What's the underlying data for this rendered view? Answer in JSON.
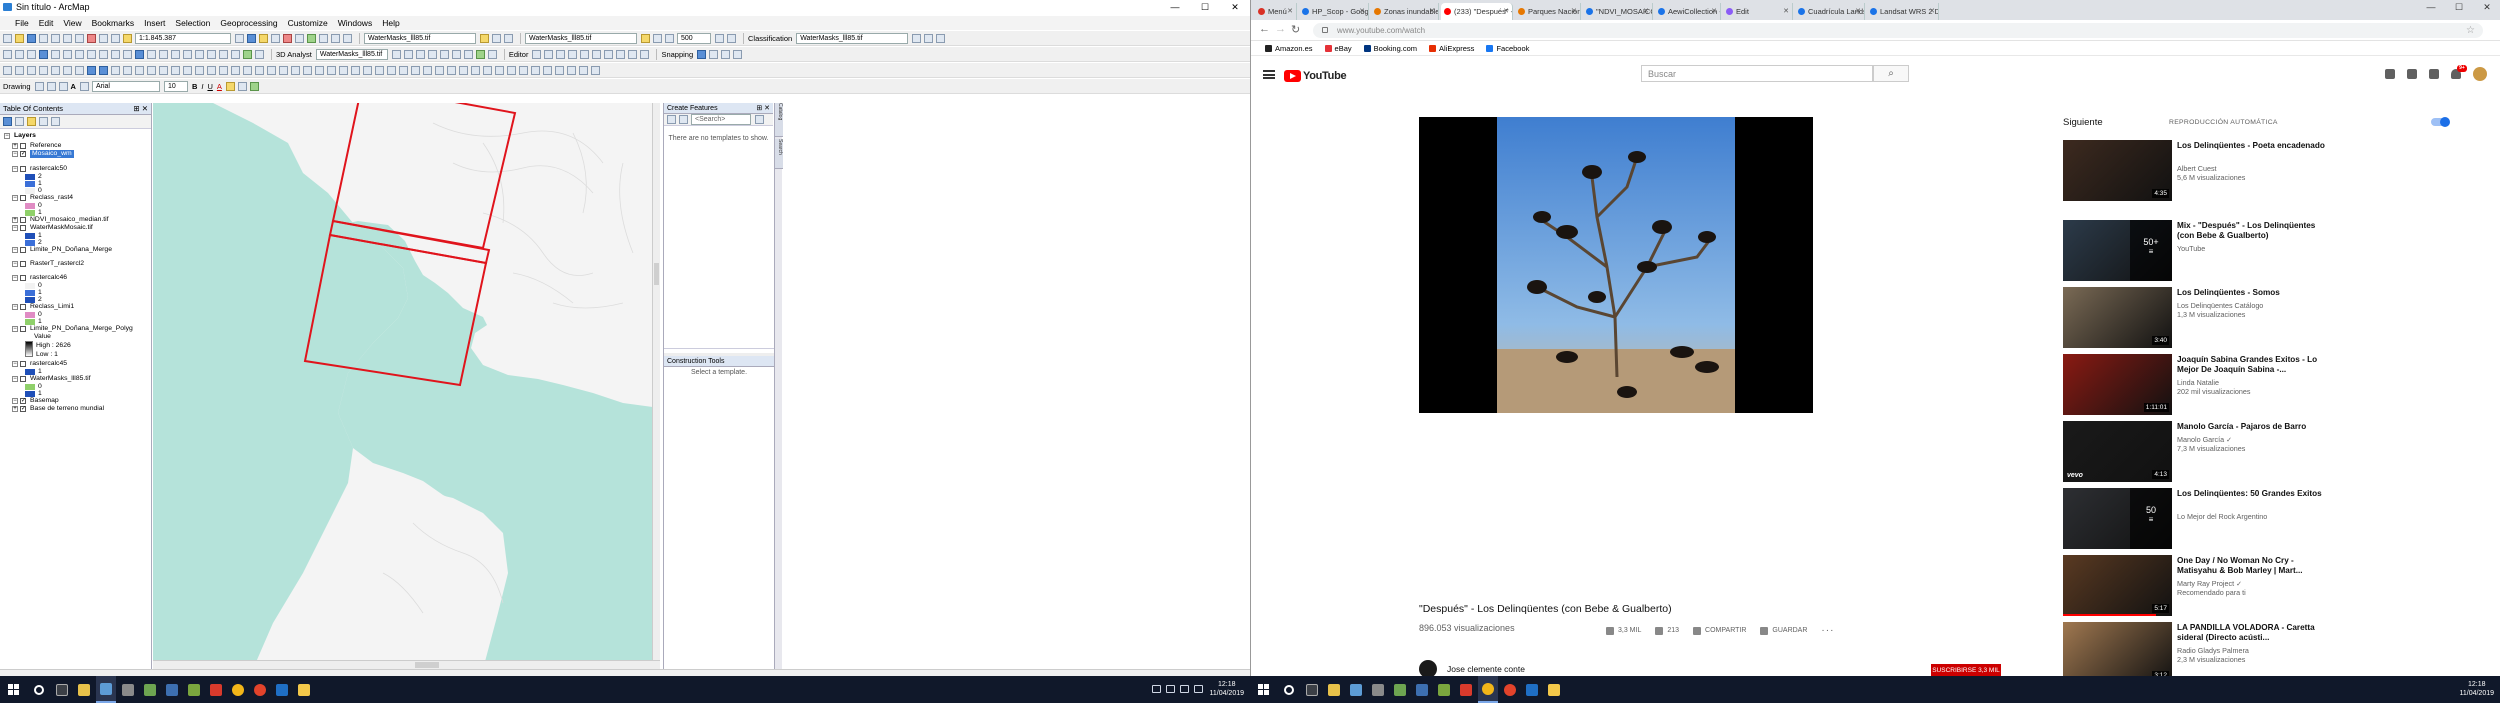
{
  "arcmap": {
    "title": "Sin título - ArcMap",
    "window_controls": [
      "—",
      "☐",
      "✕"
    ],
    "menu": [
      "File",
      "Edit",
      "View",
      "Bookmarks",
      "Insert",
      "Selection",
      "Geoprocessing",
      "Customize",
      "Windows",
      "Help"
    ],
    "toolbar": {
      "scale": "1:1.845.387",
      "layer_dropdown_1": "WaterMasks_lll85.tif",
      "layer_dropdown_2": "WaterMasks_lll85.tif",
      "layer_dropdown_3": "WaterMasks_lll85.tif",
      "classification_label": "Classification",
      "classification_dropdown": "WaterMasks_lll85.tif",
      "value_500": "500",
      "analyst_label": "3D Analyst",
      "analyst_layer": "WaterMasks_lll85.tif",
      "editor_label": "Editor",
      "snapping_label": "Snapping",
      "drawing_label": "Drawing",
      "font_name": "Arial",
      "font_size": "10",
      "bold": "B",
      "italic": "I",
      "underline": "U",
      "font_color_a": "A"
    },
    "toc": {
      "title": "Table Of Contents",
      "layers_root": "Layers",
      "items": [
        {
          "name": "Reference",
          "check": false,
          "expanded": false
        },
        {
          "name": "Mosaico_wm",
          "check": true,
          "expanded": true,
          "selected": true
        },
        {
          "name": "rastercalc50",
          "check": false,
          "expanded": true
        },
        {
          "name": "2",
          "legend": true
        },
        {
          "name": "1",
          "legend": true
        },
        {
          "name": "0",
          "legend": true
        },
        {
          "name": "Reclass_rast4",
          "check": false,
          "expanded": true
        },
        {
          "name": "0",
          "legend": true
        },
        {
          "name": "1",
          "legend": true
        },
        {
          "name": "NDVI_mosaico_median.tif",
          "check": false,
          "expanded": false
        },
        {
          "name": "WaterMaskMosaic.tif",
          "check": false,
          "expanded": true
        },
        {
          "name": "1",
          "legend": true
        },
        {
          "name": "2",
          "legend": true
        },
        {
          "name": "Limite_PN_Doñana_Merge",
          "check": false,
          "expanded": true
        },
        {
          "name": "RasterT_rastercl2",
          "check": false,
          "expanded": true
        },
        {
          "name": "rastercalc46",
          "check": false,
          "expanded": true
        },
        {
          "name": "0",
          "legend": true
        },
        {
          "name": "1",
          "legend": true
        },
        {
          "name": "2",
          "legend": true
        },
        {
          "name": "Reclass_Limi1",
          "check": false,
          "expanded": true
        },
        {
          "name": "0",
          "legend": true
        },
        {
          "name": "1",
          "legend": true
        },
        {
          "name": "Limite_PN_Doñana_Merge_Polyg",
          "check": false,
          "expanded": true
        },
        {
          "name": "Value",
          "legend": true
        },
        {
          "name": "High : 2626",
          "legend": true
        },
        {
          "name": "Low : 1",
          "legend": true
        },
        {
          "name": "rastercalc45",
          "check": false,
          "expanded": true
        },
        {
          "name": "1",
          "legend": true
        },
        {
          "name": "WaterMasks_lll85.tif",
          "check": false,
          "expanded": true
        },
        {
          "name": "0",
          "legend": true
        },
        {
          "name": "1",
          "legend": true
        },
        {
          "name": "Basemap",
          "check": true,
          "expanded": true
        },
        {
          "name": "Base de terreno mundial",
          "check": true,
          "expanded": false
        }
      ]
    },
    "create_features": {
      "title": "Create Features",
      "search_placeholder": "<Search>",
      "empty_message": "There are no templates to show."
    },
    "construction_tools": {
      "title": "Construction Tools",
      "message": "Select a template."
    },
    "side_tabs": [
      "Catalog",
      "Search"
    ]
  },
  "chrome": {
    "tabs": [
      {
        "label": "Menú",
        "color": "#d93025"
      },
      {
        "label": "HP_Scop - Google Drive",
        "color": "#1a73e8"
      },
      {
        "label": "Zonas inundables asociad",
        "color": "#e67700"
      },
      {
        "label": "(233) \"Después\" - Los Delinq",
        "color": "#ff0000",
        "active": true
      },
      {
        "label": "Parques Nacionales de Es",
        "color": "#e67700"
      },
      {
        "label": "\"NDVI_MOSAICO - Earth E",
        "color": "#1a73e8"
      },
      {
        "label": "AewiCollection - Earth E",
        "color": "#1a73e8"
      },
      {
        "label": "Edit",
        "color": "#8b5cf6"
      },
      {
        "label": "Cuadrícula Landsat | Mi",
        "color": "#1a73e8"
      },
      {
        "label": "Landsat WRS 2 Descend",
        "color": "#1a73e8"
      }
    ],
    "url": "www.youtube.com/watch",
    "bookmarks": [
      {
        "label": "Amazon.es",
        "color": "#222"
      },
      {
        "label": "eBay",
        "color": "#e53238"
      },
      {
        "label": "Booking.com",
        "color": "#003580"
      },
      {
        "label": "AliExpress",
        "color": "#e62e04"
      },
      {
        "label": "Facebook",
        "color": "#1877f2"
      }
    ]
  },
  "youtube": {
    "logo": "YouTube",
    "search_placeholder": "Buscar",
    "notification_count": "9+",
    "video": {
      "title": "\"Después\" - Los Delinqüentes (con Bebe & Gualberto)",
      "views": "896.053 visualizaciones",
      "likes": "3,3 MIL",
      "dislikes": "213",
      "share": "COMPARTIR",
      "save": "GUARDAR",
      "channel": "Jose clemente conte",
      "subscribe": "SUSCRIBIRSE 3,3 MIL"
    },
    "next_label": "Siguiente",
    "autoplay_label": "REPRODUCCIÓN AUTOMÁTICA",
    "recommendations": [
      {
        "title": "Los Delinqüentes - Poeta encadenado",
        "channel": "Albert Cuest",
        "views": "5,6 M visualizaciones",
        "duration": "4:35",
        "color": "#3d2a1f"
      },
      {
        "title": "Mix - \"Después\" - Los Delinqüentes (con Bebe & Gualberto)",
        "channel": "YouTube",
        "views": "",
        "duration": "",
        "mix": "50+",
        "color": "#2c3b4a"
      },
      {
        "title": "Los Delinqüentes - Somos",
        "channel": "Los Delinqüentes Catálogo",
        "views": "1,3 M visualizaciones",
        "duration": "3:40",
        "color": "#7a6a55"
      },
      {
        "title": "Joaquín Sabina Grandes Exitos - Lo Mejor De Joaquín Sabina -...",
        "channel": "Linda Natalie",
        "views": "202 mil visualizaciones",
        "duration": "1:11:01",
        "color": "#8a1a12"
      },
      {
        "title": "Manolo García - Pajaros de Barro",
        "channel": "Manolo García ✓",
        "views": "7,3 M visualizaciones",
        "duration": "4:13",
        "color": "#1a1a1a",
        "vevo": true
      },
      {
        "title": "Los Delinqüentes: 50 Grandes Exitos",
        "channel": "Lo Mejor del Rock Argentino",
        "views": "",
        "duration": "",
        "mix": "50",
        "color": "#2d2f33"
      },
      {
        "title": "One Day / No Woman No Cry - Matisyahu & Bob Marley | Mart...",
        "channel": "Marty Ray Project ✓",
        "views": "Recomendado para ti",
        "duration": "5:17",
        "color": "#5a3a22",
        "progress": 0.85
      },
      {
        "title": "LA PANDILLA VOLADORA - Caretta sideral (Directo acústi...",
        "channel": "Radio Gladys Palmera",
        "views": "2,3 M visualizaciones",
        "duration": "3:12",
        "color": "#a07850"
      }
    ]
  },
  "taskbar_left": {
    "date": "11/04/2019",
    "time": "12:18"
  },
  "taskbar_right": {
    "date": "11/04/2019",
    "time": "12:18"
  },
  "colors": {
    "sea": "#b5e3da",
    "land": "#f4f4f4",
    "footprint": "#e0141c",
    "selection": "#3779d4",
    "yt_red": "#ff0000"
  }
}
